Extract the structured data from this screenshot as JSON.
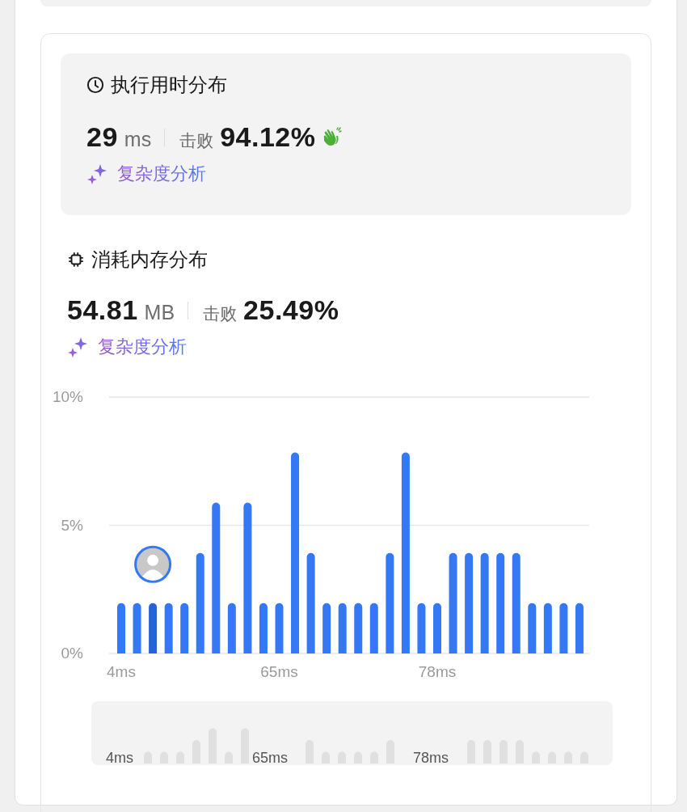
{
  "runtime": {
    "title": "执行用时分布",
    "value": "29",
    "unit": "ms",
    "beats_label": "击败",
    "beats": "94.12%",
    "link": "复杂度分析"
  },
  "memory": {
    "title": "消耗内存分布",
    "value": "54.81",
    "unit": "MB",
    "beats_label": "击败",
    "beats": "25.49%",
    "link": "复杂度分析",
    "chart_data": {
      "type": "bar",
      "ylim": [
        0,
        10
      ],
      "yticks": [
        {
          "value": 0,
          "label": "0%"
        },
        {
          "value": 5,
          "label": "5%"
        },
        {
          "value": 10,
          "label": "10%"
        }
      ],
      "categories": [
        "4ms",
        null,
        null,
        null,
        null,
        null,
        null,
        null,
        null,
        null,
        "65ms",
        null,
        null,
        null,
        null,
        null,
        null,
        null,
        null,
        null,
        "78ms",
        null,
        null,
        null,
        null,
        null,
        null,
        null,
        null,
        null
      ],
      "stacked": true,
      "series": [
        {
          "color": "#3478f6",
          "values": [
            1.96,
            1.96,
            null,
            1.96,
            1.96,
            3.92,
            5.88,
            1.96,
            5.88,
            1.96,
            1.96,
            7.84,
            3.92,
            1.96,
            1.96,
            1.96,
            1.96,
            3.92,
            7.84,
            1.96,
            1.96,
            3.92,
            3.92,
            3.92,
            3.92,
            3.92,
            1.96,
            1.96,
            1.96,
            1.96
          ]
        },
        {
          "color": "#2563d9",
          "values": [
            null,
            null,
            1.96,
            null,
            null,
            null,
            null,
            null,
            null,
            null,
            null,
            null,
            null,
            null,
            null,
            null,
            null,
            null,
            null,
            null,
            null,
            null,
            null,
            null,
            null,
            null,
            null,
            null,
            null,
            null
          ]
        }
      ]
    },
    "navigator": {
      "labels": [
        "4ms",
        "65ms",
        "78ms"
      ]
    }
  }
}
